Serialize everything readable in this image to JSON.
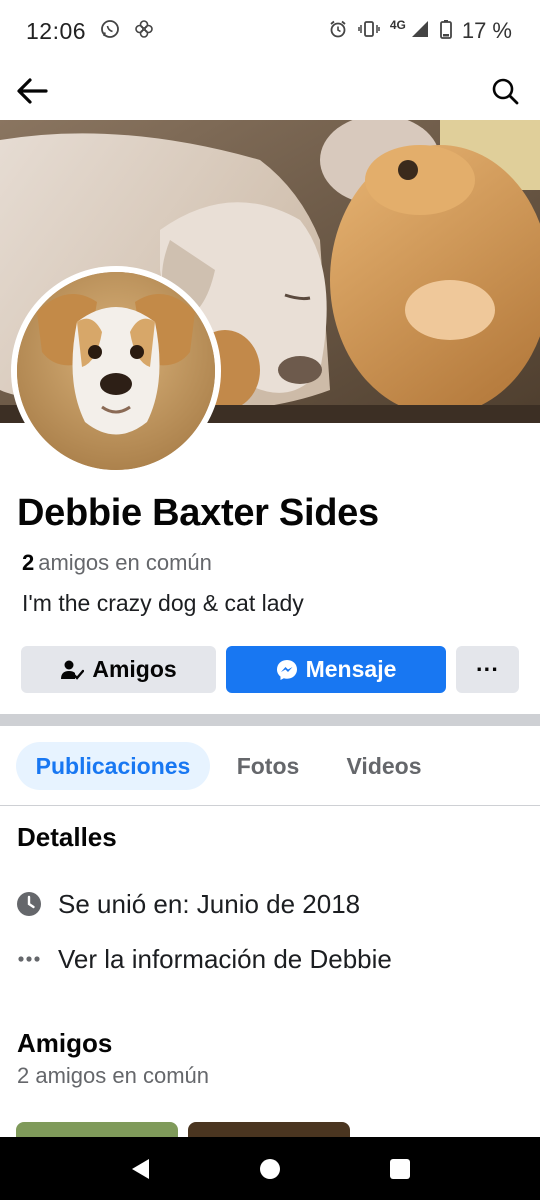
{
  "status_bar": {
    "time": "12:06",
    "network": "4G",
    "battery": "17 %"
  },
  "profile": {
    "name": "Debbie Baxter Sides",
    "mutual_count": "2",
    "mutual_label": "amigos en común",
    "bio": "I'm the crazy dog & cat lady"
  },
  "actions": {
    "friends_label": "Amigos",
    "message_label": "Mensaje",
    "more_label": "···"
  },
  "tabs": [
    {
      "label": "Publicaciones"
    },
    {
      "label": "Fotos"
    },
    {
      "label": "Videos"
    }
  ],
  "details": {
    "title": "Detalles",
    "joined": "Se unió en: Junio de 2018",
    "more_info": "Ver la información de Debbie"
  },
  "friends_section": {
    "title": "Amigos",
    "subtitle": "2 amigos en común"
  },
  "colors": {
    "accent": "#1877f2",
    "tab_active_bg": "#e7f3ff",
    "button_grey": "#e4e6eb",
    "secondary_text": "#65676b"
  }
}
